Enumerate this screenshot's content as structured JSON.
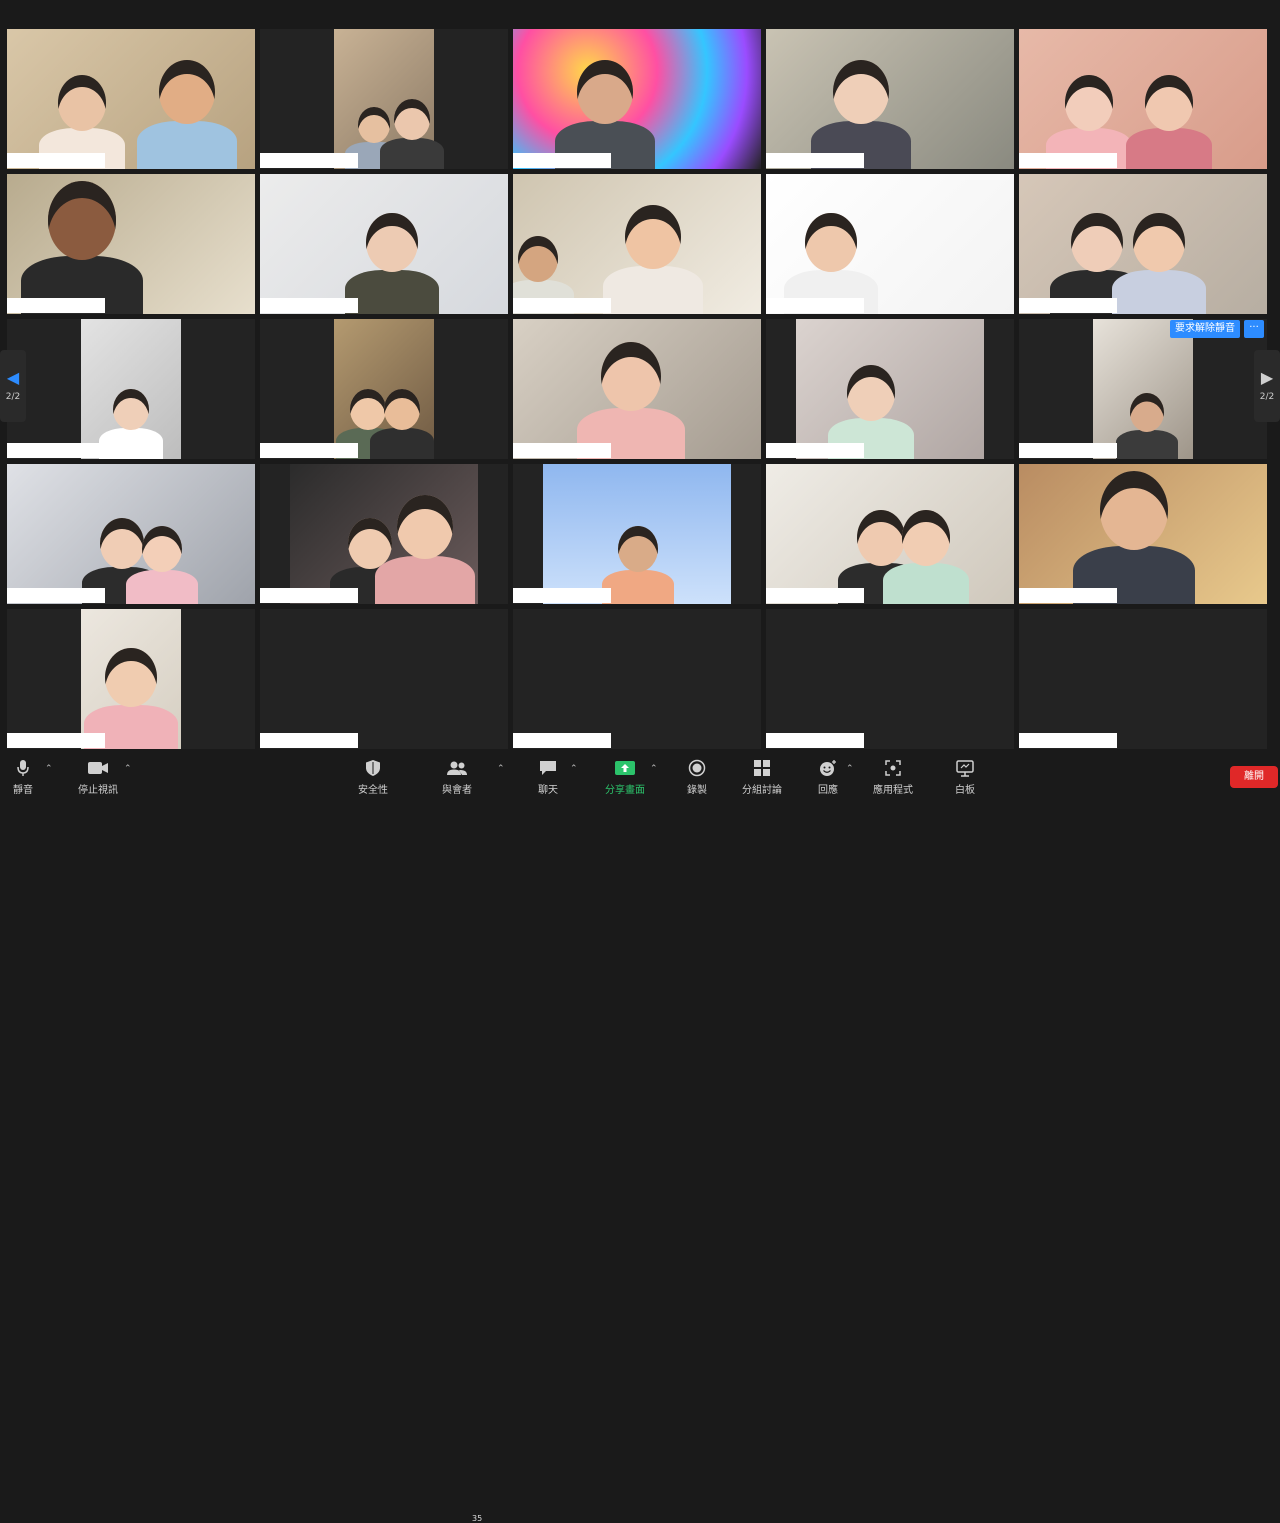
{
  "window": {
    "title": ""
  },
  "pagination": {
    "left_arrow": "◀",
    "right_arrow": "▶",
    "left_count": "2/2",
    "right_count": "2/2"
  },
  "tile_actions": {
    "request_unmute": "要求解除靜音",
    "more": "···"
  },
  "participants": [
    {
      "name": ""
    },
    {
      "name": ""
    },
    {
      "name": ""
    },
    {
      "name": ""
    },
    {
      "name": ""
    },
    {
      "name": ""
    },
    {
      "name": ""
    },
    {
      "name": ""
    },
    {
      "name": ""
    },
    {
      "name": ""
    },
    {
      "name": ""
    },
    {
      "name": ""
    },
    {
      "name": ""
    },
    {
      "name": ""
    },
    {
      "name": ""
    },
    {
      "name": ""
    },
    {
      "name": ""
    },
    {
      "name": ""
    },
    {
      "name": ""
    },
    {
      "name": ""
    },
    {
      "name": ""
    },
    {
      "name": ""
    },
    {
      "name": ""
    },
    {
      "name": ""
    },
    {
      "name": ""
    }
  ],
  "toolbar": {
    "mute": "靜音",
    "stop_video": "停止視訊",
    "security": "安全性",
    "participants": "與會者",
    "participants_count": "35",
    "chat": "聊天",
    "share_screen": "分享畫面",
    "record": "錄製",
    "breakout_rooms": "分組討論",
    "reactions": "回應",
    "apps": "應用程式",
    "whiteboard": "白板",
    "leave": "離開"
  },
  "colors": {
    "accent": "#2d8cff",
    "share_green": "#2cc36b",
    "leave_red": "#e02828",
    "background": "#1a1a1a",
    "tile": "#232323"
  }
}
